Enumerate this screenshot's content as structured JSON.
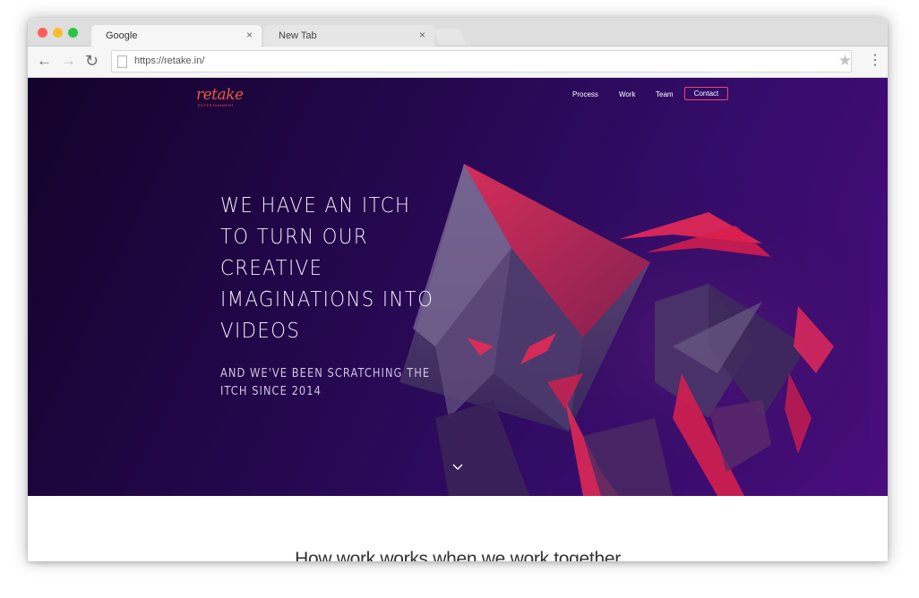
{
  "browser": {
    "tabs": [
      {
        "label": "Google",
        "close": "×"
      },
      {
        "label": "New Tab",
        "close": "×"
      }
    ],
    "url": "https://retake.in/",
    "icons": {
      "back": "arrow-left-icon",
      "forward": "arrow-right-icon",
      "reload": "reload-icon",
      "star": "star-icon",
      "menu": "more-vert-icon"
    }
  },
  "site": {
    "logo": {
      "text": "retake",
      "sub": "ENTERTAINMENT"
    },
    "nav": {
      "process": "Process",
      "work": "Work",
      "team": "Team",
      "contact": "Contact"
    },
    "hero": {
      "headline_lines": [
        "WE HAVE AN ITCH",
        "TO TURN OUR",
        "CREATIVE",
        "IMAGINATIONS INTO",
        "VIDEOS"
      ],
      "subline_lines": [
        "AND WE'VE BEEN SCRATCHING THE",
        "ITCH SINCE 2014"
      ],
      "scroll_icon": "chevron-down-icon"
    },
    "section": {
      "title": "How work works when we work together"
    }
  },
  "colors": {
    "hero_bg_start": "#14032b",
    "hero_bg_end": "#4a0d7e",
    "accent": "#f0466a",
    "logo": "#f0573f"
  }
}
